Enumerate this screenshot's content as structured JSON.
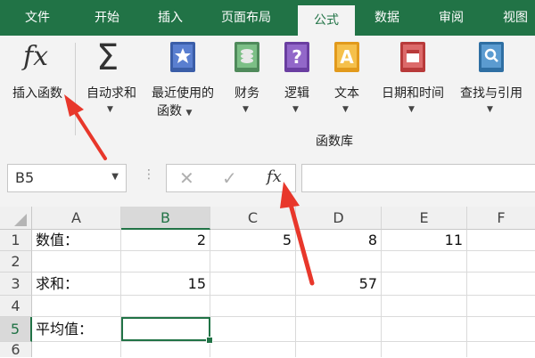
{
  "tabs": [
    "文件",
    "开始",
    "插入",
    "页面布局",
    "公式",
    "数据",
    "审阅",
    "视图"
  ],
  "active_tab": "公式",
  "ribbon": {
    "insert_function": "插入函数",
    "autosum": "自动求和",
    "recent_line1": "最近使用的",
    "recent_line2": "函数",
    "finance": "财务",
    "logic": "逻辑",
    "text": "文本",
    "datetime": "日期和时间",
    "lookup": "查找与引用",
    "group_label": "函数库",
    "fx_symbol": "fx",
    "sigma_symbol": "Σ"
  },
  "formula_bar": {
    "name_box": "B5",
    "fx_symbol": "fx",
    "formula": ""
  },
  "columns": [
    "A",
    "B",
    "C",
    "D",
    "E",
    "F"
  ],
  "rows": [
    "1",
    "2",
    "3",
    "4",
    "5",
    "6"
  ],
  "cells": {
    "A1": "数值：",
    "B1": "2",
    "C1": "5",
    "D1": "8",
    "E1": "11",
    "A3": "求和：",
    "B3": "15",
    "D3": "57",
    "A5": "平均值："
  },
  "colors": {
    "excel_green": "#217346",
    "arrow_red": "#e8372b"
  }
}
